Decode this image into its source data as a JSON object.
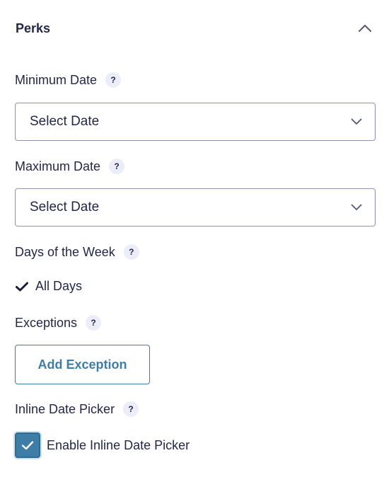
{
  "section": {
    "title": "Perks",
    "collapse_icon": "chevron-up-icon"
  },
  "minimum_date": {
    "label": "Minimum Date",
    "help": "?",
    "value": "Select Date"
  },
  "maximum_date": {
    "label": "Maximum Date",
    "help": "?",
    "value": "Select Date"
  },
  "days_of_week": {
    "label": "Days of the Week",
    "help": "?",
    "selected": "All Days"
  },
  "exceptions": {
    "label": "Exceptions",
    "help": "?",
    "button_label": "Add Exception"
  },
  "inline_picker": {
    "label": "Inline Date Picker",
    "help": "?",
    "checkbox_label": "Enable Inline Date Picker",
    "checked": true
  },
  "colors": {
    "text": "#242748",
    "accent": "#3e7da6",
    "border": "#9092b2",
    "help_bg": "#ecedf8"
  }
}
